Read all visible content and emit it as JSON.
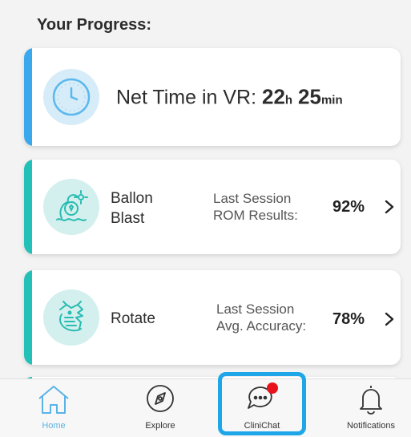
{
  "section_title": "Your Progress:",
  "time_card": {
    "label": "Net Time in VR: ",
    "hours": "22",
    "hours_unit": "h",
    "minutes": "25",
    "minutes_unit": "min",
    "icon": "clock-icon"
  },
  "games": [
    {
      "name_line1": "Ballon",
      "name_line2": "Blast",
      "stat_line1": "Last Session",
      "stat_line2": "ROM Results:",
      "value": "92%",
      "icon": "balloon-icon"
    },
    {
      "name_line1": "Rotate",
      "stat_line1": "Last Session",
      "stat_line2": "Avg. Accuracy:",
      "value": "78%",
      "icon": "dragon-icon"
    }
  ],
  "nav": {
    "home": "Home",
    "explore": "Explore",
    "clinichat": "CliniChat",
    "notifications": "Notifications"
  },
  "colors": {
    "time_accent": "#3aa8ec",
    "game_accent": "#22c0b6",
    "highlight": "#1fa6e8",
    "badge": "#e8121e"
  }
}
